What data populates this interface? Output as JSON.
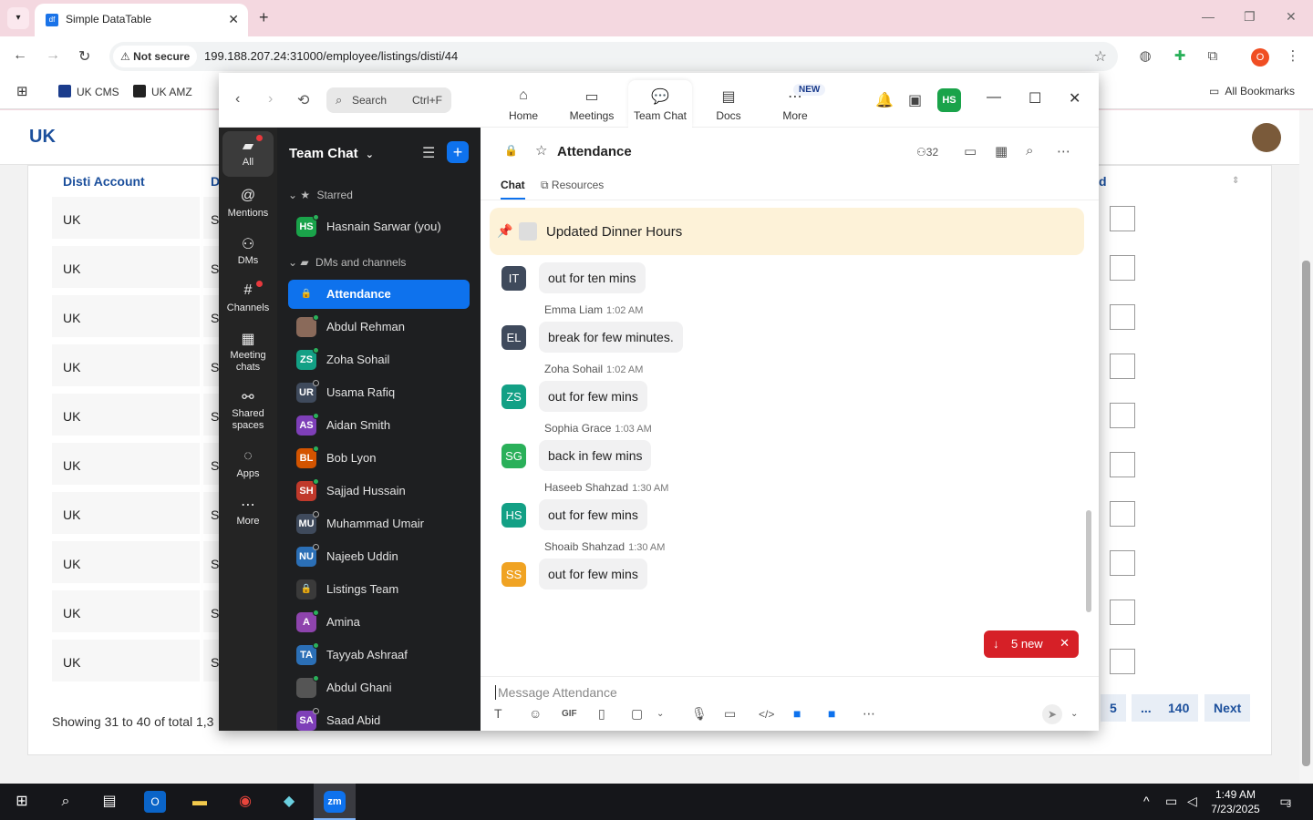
{
  "browser": {
    "tab_title": "Simple DataTable",
    "tab_favicon_text": "df",
    "url": "199.188.207.24:31000/employee/listings/disti/44",
    "security_label": "Not secure",
    "profile_letter": "O",
    "bookmarks": [
      "UK CMS",
      "UK AMZ"
    ],
    "all_bookmarks": "All Bookmarks"
  },
  "page": {
    "logo": "UK",
    "table_headers": [
      "Disti Account",
      "D",
      "d"
    ],
    "rows": [
      "UK",
      "UK",
      "UK",
      "UK",
      "UK",
      "UK",
      "UK",
      "UK",
      "UK",
      "UK"
    ],
    "second_col_peek": "S",
    "showing": "Showing 31 to 40 of total 1,3",
    "pagination": [
      "5",
      "...",
      "140",
      "Next"
    ]
  },
  "zoom": {
    "search_placeholder": "Search",
    "search_shortcut": "Ctrl+F",
    "tabs": [
      {
        "label": "Home",
        "icon": "home-icon"
      },
      {
        "label": "Meetings",
        "icon": "video-icon"
      },
      {
        "label": "Team Chat",
        "icon": "chat-icon"
      },
      {
        "label": "Docs",
        "icon": "doc-icon"
      },
      {
        "label": "More",
        "icon": "more-icon"
      }
    ],
    "new_badge": "NEW",
    "user_initials": "HS",
    "rail": [
      {
        "label": "All",
        "icon": "chat-bubble-icon"
      },
      {
        "label": "Mentions",
        "icon": "at-icon"
      },
      {
        "label": "DMs",
        "icon": "people-icon"
      },
      {
        "label": "Channels",
        "icon": "hash-icon"
      },
      {
        "label": "Meeting chats",
        "icon": "calendar-icon"
      },
      {
        "label": "Shared spaces",
        "icon": "share-icon"
      },
      {
        "label": "Apps",
        "icon": "apps-icon"
      },
      {
        "label": "More",
        "icon": "ellipsis-icon"
      }
    ],
    "sidebar": {
      "title": "Team Chat",
      "starred_label": "Starred",
      "starred": [
        {
          "initials": "HS",
          "name": "Hasnain Sarwar (you)",
          "color": "#1aa34a"
        }
      ],
      "dms_label": "DMs and channels",
      "items": [
        {
          "initials": "",
          "name": "Attendance",
          "color": "#0e72ed",
          "active": true
        },
        {
          "initials": "",
          "name": "Abdul Rehman",
          "color": "#8a6a5a"
        },
        {
          "initials": "ZS",
          "name": "Zoha Sohail",
          "color": "#13a085"
        },
        {
          "initials": "UR",
          "name": "Usama Rafiq",
          "color": "#3f4a5c"
        },
        {
          "initials": "AS",
          "name": "Aidan Smith",
          "color": "#7e3fb8"
        },
        {
          "initials": "BL",
          "name": "Bob Lyon",
          "color": "#d35400"
        },
        {
          "initials": "SH",
          "name": "Sajjad Hussain",
          "color": "#c0392b"
        },
        {
          "initials": "MU",
          "name": "Muhammad Umair",
          "color": "#3f4a5c"
        },
        {
          "initials": "NU",
          "name": "Najeeb Uddin",
          "color": "#2b6fb6"
        },
        {
          "initials": "",
          "name": "Listings Team",
          "color": "#3a3a3a"
        },
        {
          "initials": "A",
          "name": "Amina",
          "color": "#8e44ad"
        },
        {
          "initials": "TA",
          "name": "Tayyab Ashraaf",
          "color": "#2b6fb6"
        },
        {
          "initials": "",
          "name": "Abdul Ghani",
          "color": "#555555"
        },
        {
          "initials": "SA",
          "name": "Saad Abid",
          "color": "#7e3fb8"
        }
      ]
    },
    "channel": {
      "name": "Attendance",
      "member_count": "32",
      "tabs": [
        "Chat",
        "Resources"
      ],
      "pinned": "Updated Dinner Hours",
      "messages": [
        {
          "initials": "IT",
          "color": "#3f4a5c",
          "sender": "",
          "time": "",
          "text": "out for ten mins"
        },
        {
          "initials": "EL",
          "color": "#3f4a5c",
          "sender": "Emma Liam",
          "time": "1:02 AM",
          "text": "break for few minutes."
        },
        {
          "initials": "ZS",
          "color": "#13a085",
          "sender": "Zoha Sohail",
          "time": "1:02 AM",
          "text": "out for few mins"
        },
        {
          "initials": "SG",
          "color": "#2ab05a",
          "sender": "Sophia Grace",
          "time": "1:03 AM",
          "text": "back in few mins"
        },
        {
          "initials": "HS",
          "color": "#13a085",
          "sender": "Haseeb Shahzad",
          "time": "1:30 AM",
          "text": "out for few mins"
        },
        {
          "initials": "SS",
          "color": "#f0a323",
          "sender": "Shoaib Shahzad",
          "time": "1:30 AM",
          "text": "out for few mins"
        }
      ],
      "new_count": "5 new",
      "composer_placeholder": "Message Attendance"
    }
  },
  "taskbar": {
    "time": "1:49 AM",
    "date": "7/23/2025",
    "notif_count": "3",
    "zoom_label": "zm"
  }
}
